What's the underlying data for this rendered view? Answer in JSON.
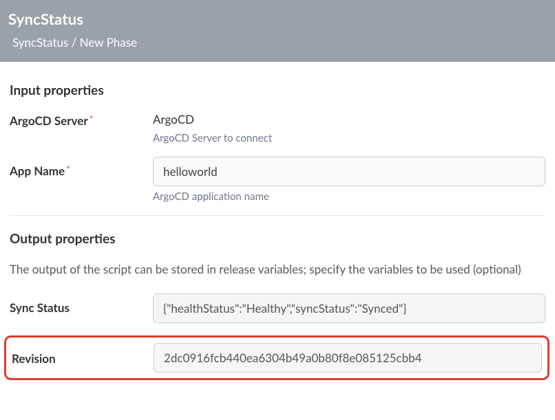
{
  "header": {
    "title": "SyncStatus",
    "breadcrumb": "SyncStatus / New Phase"
  },
  "input_section": {
    "title": "Input properties",
    "server": {
      "label": "ArgoCD Server",
      "value": "ArgoCD",
      "help": "ArgoCD Server to connect"
    },
    "app_name": {
      "label": "App Name",
      "value": "helloworld",
      "help": "ArgoCD application name"
    }
  },
  "output_section": {
    "title": "Output properties",
    "subtext": "The output of the script can be stored in release variables; specify the variables to be used (optional)",
    "sync_status": {
      "label": "Sync Status",
      "value": "{\"healthStatus\":\"Healthy\",\"syncStatus\":\"Synced\"}"
    },
    "revision": {
      "label": "Revision",
      "value": "2dc0916fcb440ea6304b49a0b80f8e085125cbb4"
    }
  }
}
